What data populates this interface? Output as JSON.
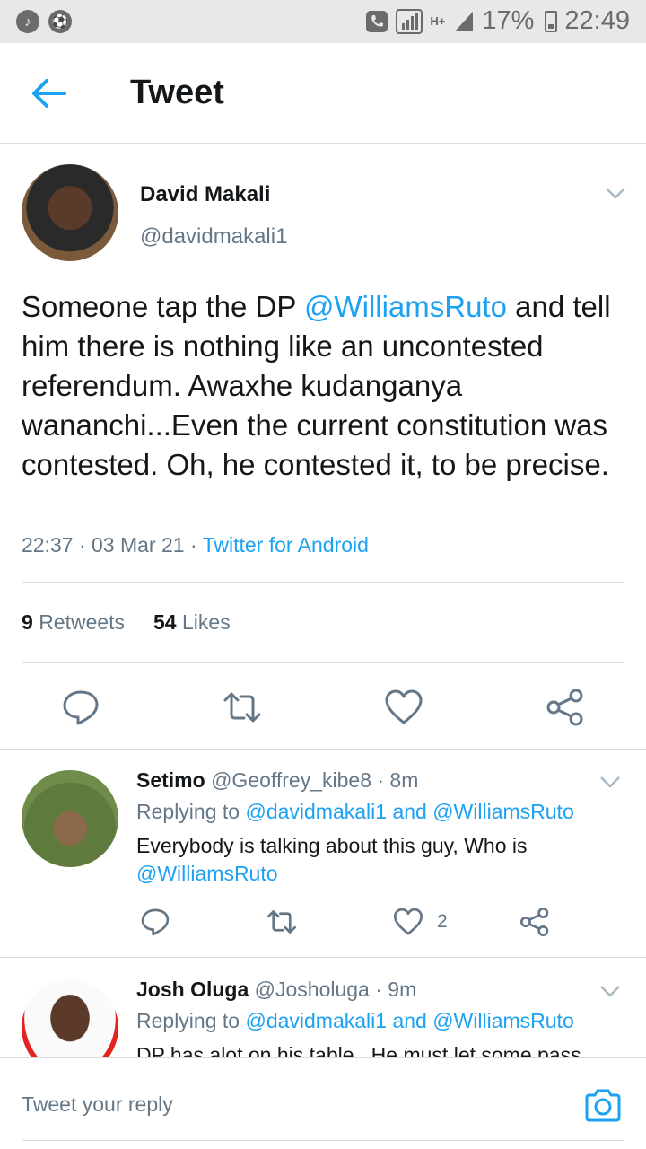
{
  "status_bar": {
    "battery": "17%",
    "time": "22:49",
    "network": "H+"
  },
  "header": {
    "title": "Tweet"
  },
  "tweet": {
    "author_name": "David Makali",
    "author_handle": "@davidmakali1",
    "text_part1": "Someone tap the DP ",
    "mention": "@WilliamsRuto",
    "text_part2": " and tell him there is nothing like an uncontested referendum. Awaxhe kudanganya wananchi...Even the current constitution was contested. Oh, he contested it, to be precise.",
    "timestamp": "22:37 · 03 Mar 21 · ",
    "source": "Twitter for Android",
    "retweets_count": "9",
    "retweets_label": "Retweets",
    "likes_count": "54",
    "likes_label": "Likes"
  },
  "replies": [
    {
      "name": "Setimo",
      "handle": "@Geoffrey_kibe8 · 8m",
      "replying_label": "Replying to ",
      "replying_to": "@davidmakali1 and @WilliamsRuto",
      "text": "Everybody is talking about this guy, Who is ",
      "text_mention": "@WilliamsRuto",
      "likes": "2"
    },
    {
      "name": "Josh Oluga",
      "handle": "@Josholuga · 9m",
      "replying_label": "Replying to ",
      "replying_to": "@davidmakali1 and @WilliamsRuto",
      "text": "DP has alot on his table . He must let some pass"
    }
  ],
  "composer": {
    "placeholder": "Tweet your reply"
  },
  "colors": {
    "accent": "#1da1f2",
    "secondary_text": "#657786",
    "divider": "#d8dde1"
  },
  "icons": {
    "back": "arrow-left-icon",
    "reply": "reply-icon",
    "retweet": "retweet-icon",
    "like": "heart-icon",
    "share": "share-icon",
    "more": "chevron-down-icon",
    "camera": "camera-icon"
  }
}
